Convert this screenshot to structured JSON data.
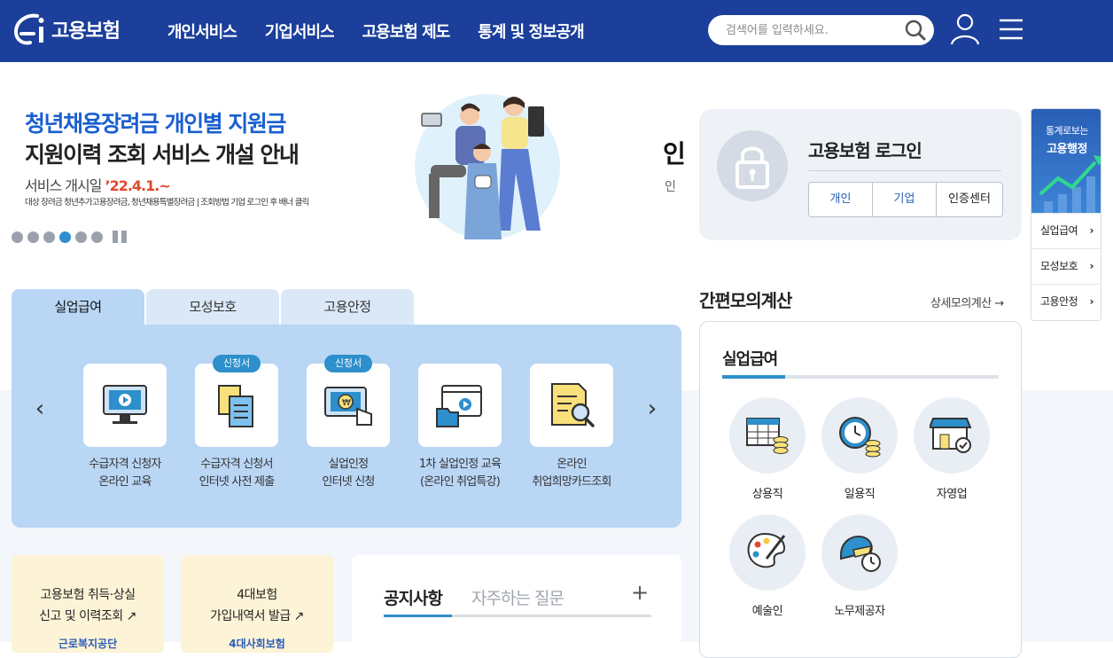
{
  "header": {
    "logo_text": "고용보험",
    "nav": [
      "개인서비스",
      "기업서비스",
      "고용보험 제도",
      "통계 및 정보공개"
    ],
    "search_placeholder": "검색어를 입력하세요."
  },
  "banner": {
    "title_line1": "청년채용장려금 개인별 지원금",
    "title_line2": "지원이력 조회 서비스 개설 안내",
    "date_prefix": "서비스 개시일 ",
    "date_value": "’22.4.1.~",
    "small_text": "대상 장려금 청년추가고용장려금, 청년채용특별장려금 | 조회방법 기업 로그인 후 배너 클릭",
    "next_peek_title": "인",
    "next_peek_sub": "인",
    "active_slide_index": 4,
    "slide_count": 6
  },
  "login": {
    "title": "고용보험 로그인",
    "buttons": [
      "개인",
      "기업",
      "인증센터"
    ]
  },
  "float_panel": {
    "top_line1": "통계로보는",
    "top_line2": "고용행정",
    "items": [
      "실업급여",
      "모성보호",
      "고용안정"
    ]
  },
  "tabs": [
    "실업급여",
    "모성보호",
    "고용안정"
  ],
  "services": [
    {
      "line1": "수급자격 신청자",
      "line2": "온라인 교육",
      "badge": "",
      "icon": "monitor-play-icon"
    },
    {
      "line1": "수급자격 신청서",
      "line2": "인터넷 사전 제출",
      "badge": "신청서",
      "icon": "documents-icon"
    },
    {
      "line1": "실업인정",
      "line2": "인터넷 신청",
      "badge": "신청서",
      "icon": "monitor-won-click-icon"
    },
    {
      "line1": "1차 실업인정 교육",
      "line2": "(온라인 취업특강)",
      "badge": "",
      "icon": "video-folder-icon"
    },
    {
      "line1": "온라인",
      "line2": "취업희망카드조회",
      "badge": "",
      "icon": "document-search-icon"
    }
  ],
  "quick_boxes": [
    {
      "line1": "고용보험 취득·상실",
      "line2": "신고 및 이력조회 ↗",
      "org": "근로복지공단"
    },
    {
      "line1": "4대보험",
      "line2": "가입내역서 발급 ↗",
      "org": "4대사회보험"
    }
  ],
  "notice": {
    "tab_active": "공지사항",
    "tab_inactive": "자주하는 질문",
    "more": "+"
  },
  "calc": {
    "title": "간편모의계산",
    "detail_link": "상세모의계산 →",
    "subtitle": "실업급여",
    "items": [
      {
        "label": "상용직",
        "icon": "calendar-coins-icon"
      },
      {
        "label": "일용직",
        "icon": "clock-coins-icon"
      },
      {
        "label": "자영업",
        "icon": "store-check-icon"
      },
      {
        "label": "예술인",
        "icon": "palette-brush-icon"
      },
      {
        "label": "노무제공자",
        "icon": "helmet-clock-icon"
      }
    ]
  },
  "colors": {
    "header_bg": "#1b3f9a",
    "accent_blue": "#2d8fcb",
    "title_blue": "#1a5fd0",
    "date_red": "#e0482e",
    "tab_panel": "#b9d6f5",
    "quick_box": "#fdf3d6"
  }
}
